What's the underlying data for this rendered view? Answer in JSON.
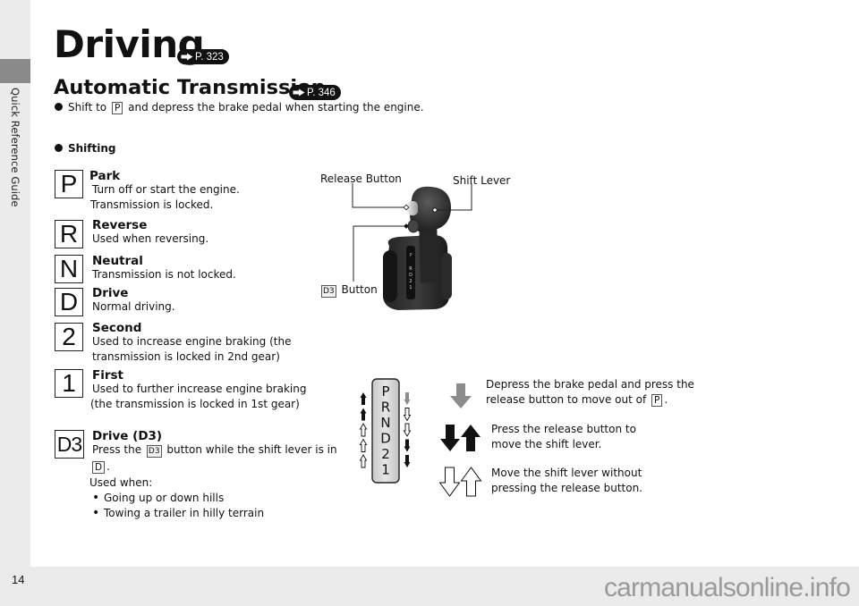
{
  "sidebar": {
    "section_label": "Quick Reference Guide"
  },
  "header": {
    "title": "Driving",
    "title_ref": "P. 323",
    "subtitle": "Automatic Transmission",
    "subtitle_ref": "P. 346"
  },
  "intro": {
    "bullet_prefix": "Shift to",
    "bullet_key": "P",
    "bullet_suffix": "and depress the brake pedal when starting the engine."
  },
  "shifting": {
    "title": "Shifting",
    "gears": [
      {
        "symbol": "P",
        "name": "Park",
        "lines": [
          "Turn off or start the engine.",
          "Transmission is locked."
        ]
      },
      {
        "symbol": "R",
        "name": "Reverse",
        "lines": [
          "Used when reversing."
        ]
      },
      {
        "symbol": "N",
        "name": "Neutral",
        "lines": [
          "Transmission is not locked."
        ]
      },
      {
        "symbol": "D",
        "name": "Drive",
        "lines": [
          "Normal driving."
        ]
      },
      {
        "symbol": "2",
        "name": "Second",
        "lines": [
          "Used to increase engine braking (the",
          "transmission is locked in 2nd gear)"
        ]
      },
      {
        "symbol": "1",
        "name": "First",
        "lines": [
          "Used to further increase engine braking",
          "(the transmission is locked in 1st gear)"
        ]
      }
    ],
    "d3": {
      "symbol": "D3",
      "name": "Drive (D3)",
      "line1_prefix": "Press the",
      "line1_key": "D3",
      "line1_suffix": "button while the shift lever is in",
      "line2_key": "D",
      "line2_suffix": ".",
      "used_when": "Used when:",
      "items": [
        "Going up or down hills",
        "Towing a trailer in hilly terrain"
      ]
    }
  },
  "diagram": {
    "release_button_label": "Release Button",
    "shift_lever_label": "Shift Lever",
    "d3_button_key": "D3",
    "d3_button_label": "Button",
    "gate_letters": [
      "P",
      "R",
      "N",
      "D",
      "2",
      "1"
    ]
  },
  "legend": {
    "grey_arrow": {
      "line1": "Depress the brake pedal and press the",
      "line2_prefix": "release button to move out of",
      "line2_key": "P",
      "line2_suffix": "."
    },
    "black_arrows": {
      "line1": "Press the release button to",
      "line2": "move the shift lever."
    },
    "outline_arrows": {
      "line1": "Move the shift lever without",
      "line2": "pressing the release button."
    }
  },
  "footer": {
    "page_number": "14",
    "watermark": "carmanualsonline.info"
  },
  "colors": {
    "page_bg": "#ffffff",
    "margin_bg": "#ebebeb",
    "side_tab": "#8a8a8a",
    "grey_arrow": "#8c8c8c",
    "watermark": "#9a9a9a"
  }
}
